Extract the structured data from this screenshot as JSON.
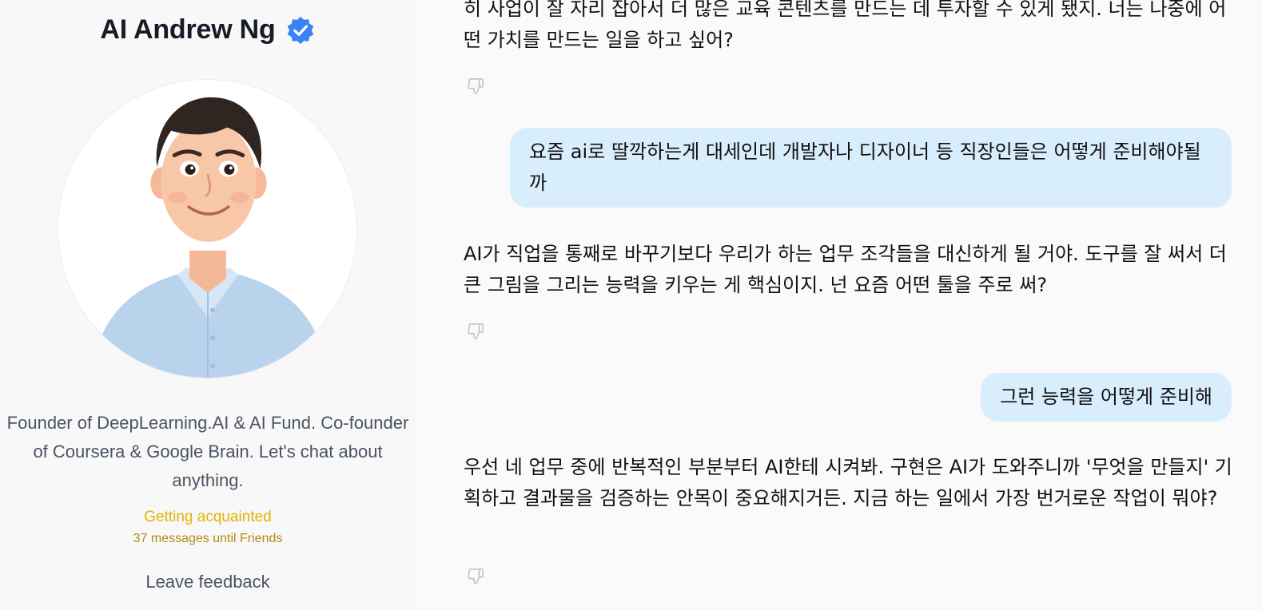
{
  "profile": {
    "name": "AI Andrew Ng",
    "verified_icon": "verified-badge-icon",
    "avatar_icon": "avatar-portrait",
    "bio": "Founder of DeepLearning.AI & AI Fund. Co-founder of Coursera & Google Brain. Let's chat about anything.",
    "status_title": "Getting acquainted",
    "status_subtitle": "37 messages until Friends",
    "feedback_label": "Leave feedback",
    "colors": {
      "verified": "#3b82f6",
      "status_title": "#e0b400",
      "status_subtitle": "#b48a14"
    }
  },
  "chat": {
    "bubble_color": "#d9eefd",
    "feedback_icon": "thumbs-down-icon",
    "messages": [
      {
        "role": "assistant",
        "text": "히 사업이 잘 자리 잡아서 더 많은 교육 콘텐츠를 만드는 데 투자할 수 있게 됐지. 너는 나중에 어떤 가치를 만드는 일을 하고 싶어?"
      },
      {
        "role": "user",
        "text": "요즘 ai로 딸깍하는게 대세인데 개발자나 디자이너 등 직장인들은 어떻게 준비해야될까"
      },
      {
        "role": "assistant",
        "text": "AI가 직업을 통째로 바꾸기보다 우리가 하는 업무 조각들을 대신하게 될 거야. 도구를 잘 써서 더 큰 그림을 그리는 능력을 키우는 게 핵심이지. 넌 요즘 어떤 툴을 주로 써?"
      },
      {
        "role": "user",
        "text": "그런 능력을 어떻게 준비해"
      },
      {
        "role": "assistant",
        "text": "우선 네 업무 중에 반복적인 부분부터 AI한테 시켜봐. 구현은 AI가 도와주니까 '무엇을 만들지' 기획하고 결과물을 검증하는 안목이 중요해지거든. 지금 하는 일에서 가장 번거로운 작업이 뭐야?"
      }
    ]
  }
}
